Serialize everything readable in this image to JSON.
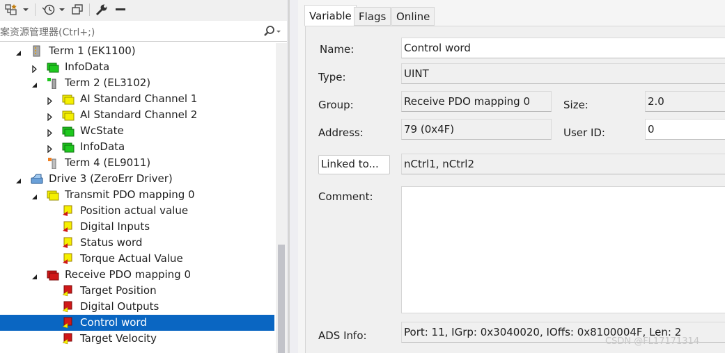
{
  "toolbar": {
    "icons": [
      "solution-explorer-icon",
      "dropdown-arrow-icon",
      "history-icon",
      "dropdown-arrow-icon",
      "copy-windows-icon",
      "wrench-icon",
      "minus-icon"
    ]
  },
  "search": {
    "placeholder": "案资源管理器(Ctrl+;)"
  },
  "tree": {
    "rows": [
      {
        "label": "Term 1 (EK1100)",
        "expander": "expanded",
        "icon": "coupler-icon"
      },
      {
        "label": "InfoData",
        "expander": "collapsed",
        "icon": "green-var-icon"
      },
      {
        "label": "Term 2 (EL3102)",
        "expander": "expanded",
        "icon": "terminal-icon"
      },
      {
        "label": "AI Standard Channel 1",
        "expander": "collapsed",
        "icon": "yellow-var-icon"
      },
      {
        "label": "AI Standard Channel 2",
        "expander": "collapsed",
        "icon": "yellow-var-icon"
      },
      {
        "label": "WcState",
        "expander": "collapsed",
        "icon": "green-var-icon"
      },
      {
        "label": "InfoData",
        "expander": "collapsed",
        "icon": "green-var-icon"
      },
      {
        "label": "Term 4 (EL9011)",
        "expander": "none",
        "icon": "end-terminal-icon"
      },
      {
        "label": "Drive 3 (ZeroErr Driver)",
        "expander": "expanded",
        "icon": "drive-icon"
      },
      {
        "label": "Transmit PDO mapping 0",
        "expander": "expanded",
        "icon": "yellow-var-icon"
      },
      {
        "label": "Position actual value",
        "expander": "none",
        "icon": "input-var-icon"
      },
      {
        "label": "Digital Inputs",
        "expander": "none",
        "icon": "input-var-icon"
      },
      {
        "label": "Status word",
        "expander": "none",
        "icon": "input-var-icon"
      },
      {
        "label": "Torque Actual Value",
        "expander": "none",
        "icon": "input-var-icon"
      },
      {
        "label": "Receive PDO mapping 0",
        "expander": "expanded",
        "icon": "red-var-icon"
      },
      {
        "label": "Target Position",
        "expander": "none",
        "icon": "output-var-icon"
      },
      {
        "label": "Digital Outputs",
        "expander": "none",
        "icon": "output-var-icon"
      },
      {
        "label": "Control word",
        "expander": "none",
        "icon": "output-var-icon",
        "selected": true
      },
      {
        "label": "Target Velocity",
        "expander": "none",
        "icon": "output-var-icon"
      }
    ]
  },
  "tabs": [
    {
      "label": "Variable",
      "active": true
    },
    {
      "label": "Flags",
      "active": false
    },
    {
      "label": "Online",
      "active": false
    }
  ],
  "form": {
    "name_label": "Name:",
    "name_value": "Control word",
    "type_label": "Type:",
    "type_value": "UINT",
    "group_label": "Group:",
    "group_value": "Receive PDO mapping 0",
    "size_label": "Size:",
    "size_value": "2.0",
    "address_label": "Address:",
    "address_value": "79 (0x4F)",
    "userid_label": "User ID:",
    "userid_value": "0",
    "linked_button": "Linked to...",
    "linked_value": "nCtrl1, nCtrl2",
    "comment_label": "Comment:",
    "comment_value": "",
    "ads_label": "ADS Info:",
    "ads_value": "Port: 11, IGrp: 0x3040020, IOffs: 0x8100004F, Len: 2"
  },
  "watermark": "CSDN @FL17171314",
  "colors": {
    "selection": "#0a66c2",
    "panel_bg": "#f0f0f0",
    "green_icon": "#1ec81e",
    "yellow_icon": "#f5f000",
    "red_icon": "#d01818"
  }
}
